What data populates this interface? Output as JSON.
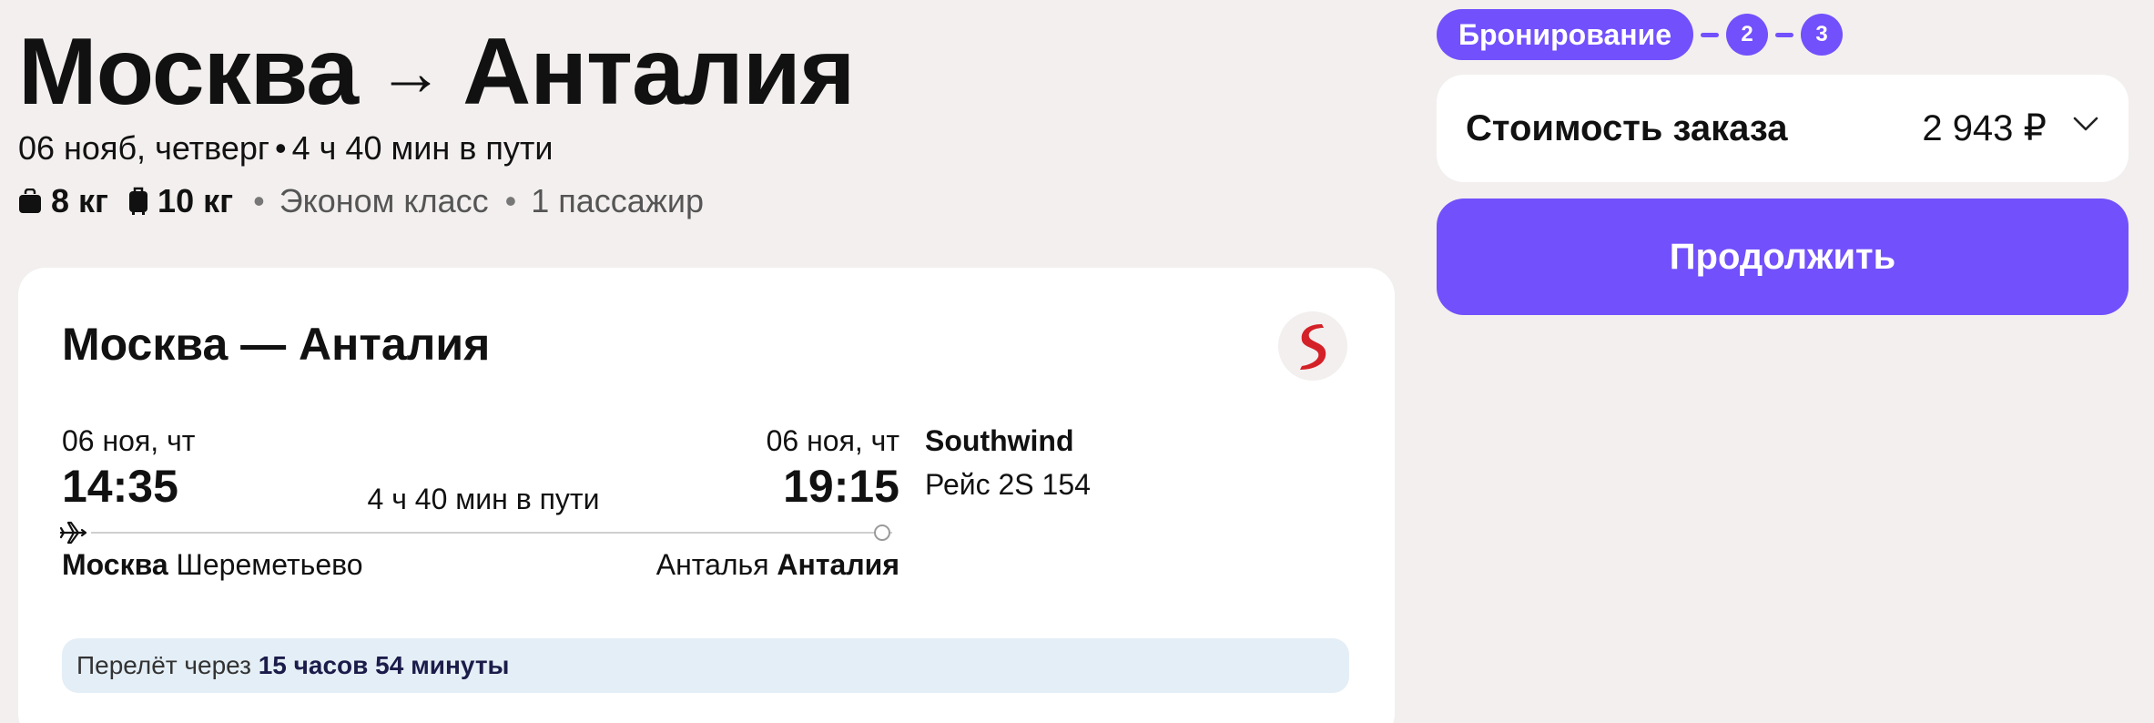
{
  "header": {
    "origin": "Москва",
    "arrow": "→",
    "destination": "Анталия",
    "date_weekday": "06 нояб, четверг",
    "dot": "•",
    "total_duration": "4 ч 40 мин в пути",
    "baggage_hand": "8 кг",
    "baggage_checked": "10 кг",
    "separator": "•",
    "cabin_class": "Эконом класс",
    "passengers": "1 пассажир"
  },
  "flight_card": {
    "title": "Москва — Анталия",
    "departure": {
      "date": "06 ноя, чт",
      "time": "14:35",
      "city": "Москва",
      "airport": "Шереметьево"
    },
    "arrival": {
      "date": "06 ноя, чт",
      "time": "19:15",
      "city": "Анталья",
      "airport": "Анталия"
    },
    "duration": "4 ч 40 мин в пути",
    "airline": "Southwind",
    "flight_number": "Рейс 2S 154",
    "notice_prefix": "Перелёт через",
    "notice_time": "15 часов 54 минуты"
  },
  "steps": {
    "active_label": "Бронирование",
    "step2": "2",
    "step3": "3"
  },
  "order": {
    "cost_label": "Стоимость заказа",
    "cost_value": "2 943 ₽"
  },
  "actions": {
    "continue_label": "Продолжить"
  },
  "colors": {
    "accent": "#7250fc",
    "background": "#f2efee",
    "card": "#ffffff",
    "notice_bg": "#e4eef6",
    "airline_logo": "#d42027"
  },
  "icons": {
    "hand_baggage": "bag-icon",
    "checked_baggage": "suitcase-icon",
    "plane": "plane-icon",
    "chevron": "chevron-down-icon",
    "airline": "southwind-logo"
  }
}
